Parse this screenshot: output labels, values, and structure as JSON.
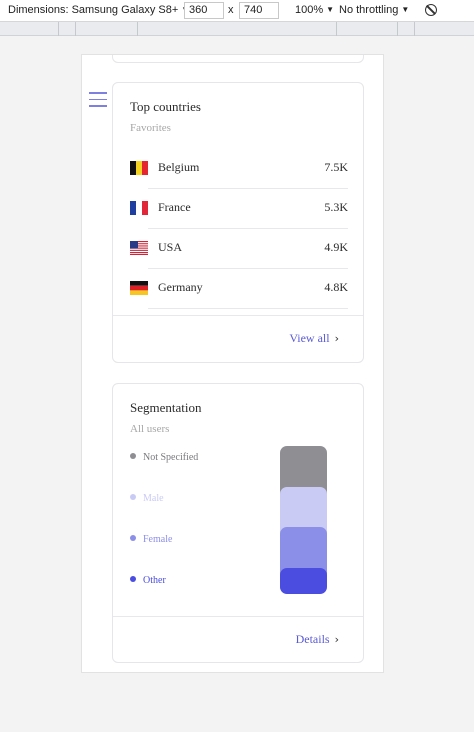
{
  "devtools": {
    "dimensions_label": "Dimensions: Samsung Galaxy S8+",
    "width": "360",
    "times": "x",
    "height": "740",
    "zoom": "100%",
    "throttling": "No throttling",
    "icon_rotate": "rotate-icon"
  },
  "countries_card": {
    "title": "Top countries",
    "subtitle": "Favorites",
    "rows": [
      {
        "name": "Belgium",
        "value": "7.5K",
        "flag": "belgium-flag"
      },
      {
        "name": "France",
        "value": "5.3K",
        "flag": "france-flag"
      },
      {
        "name": "USA",
        "value": "4.9K",
        "flag": "usa-flag"
      },
      {
        "name": "Germany",
        "value": "4.8K",
        "flag": "germany-flag"
      }
    ],
    "link_label": "View all"
  },
  "segmentation_card": {
    "title": "Segmentation",
    "subtitle": "All users",
    "legend": [
      {
        "label": "Not Specified",
        "color": "#8e8e93"
      },
      {
        "label": "Male",
        "color": "#c9cbf5"
      },
      {
        "label": "Female",
        "color": "#8c8fe8"
      },
      {
        "label": "Other",
        "color": "#4a4de0"
      }
    ],
    "link_label": "Details"
  },
  "colors": {
    "accent": "#5a5ad6",
    "hamburger": "#7f7fe0"
  }
}
